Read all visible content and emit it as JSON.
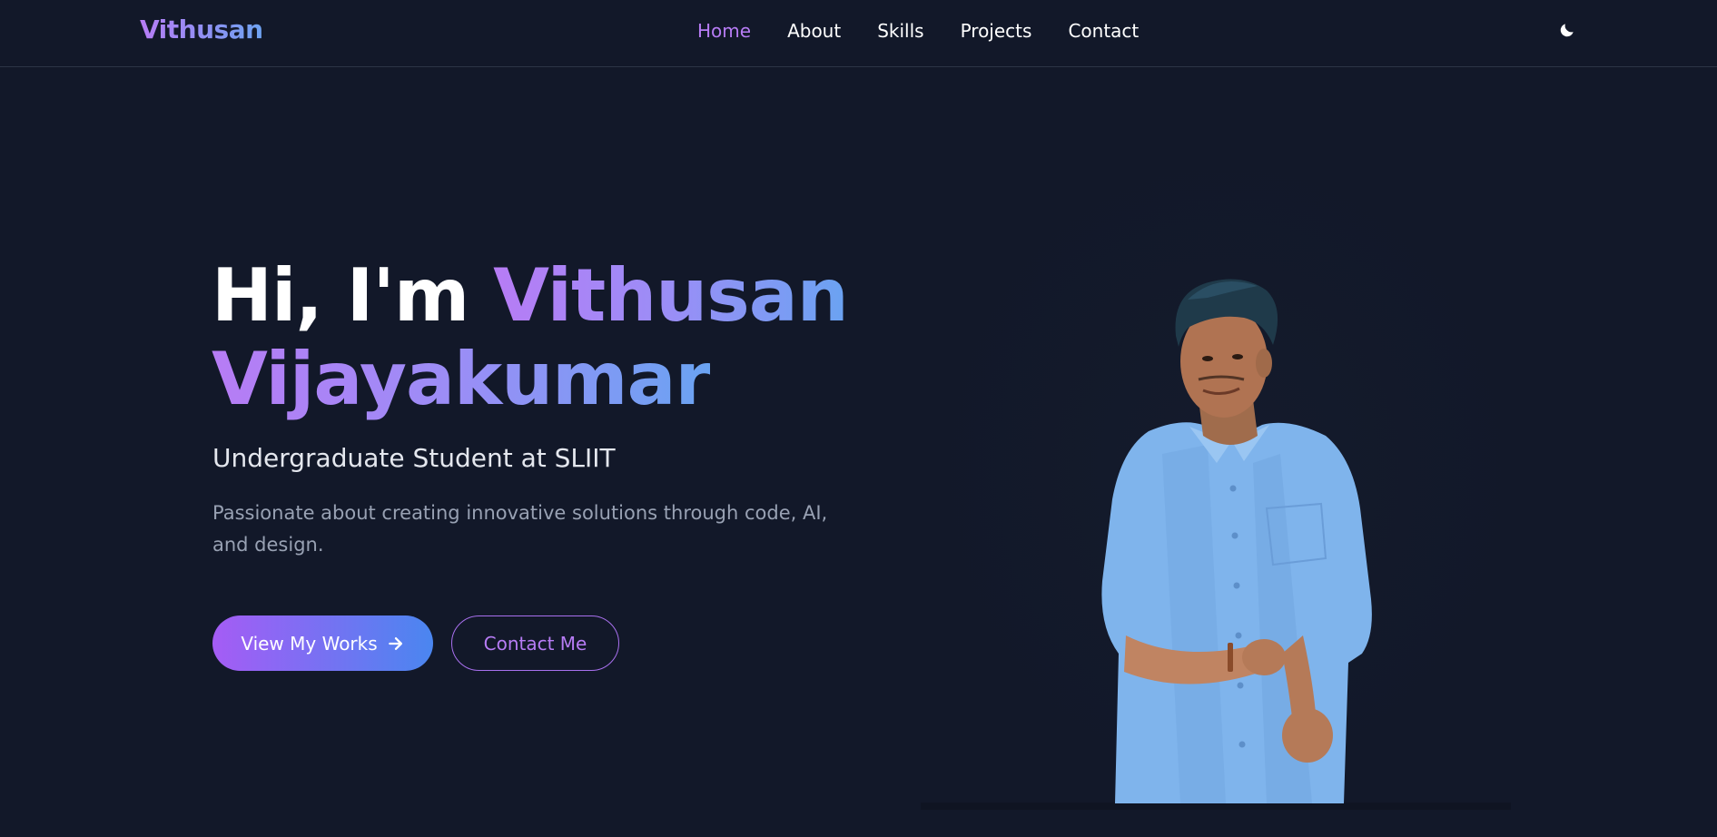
{
  "nav": {
    "brand": "Vithusan",
    "links": [
      {
        "label": "Home",
        "active": true
      },
      {
        "label": "About",
        "active": false
      },
      {
        "label": "Skills",
        "active": false
      },
      {
        "label": "Projects",
        "active": false
      },
      {
        "label": "Contact",
        "active": false
      }
    ],
    "theme_icon": "moon-icon"
  },
  "hero": {
    "greeting": "Hi, I'm ",
    "first_name": "Vithusan",
    "last_name": "Vijayakumar",
    "subtitle": "Undergraduate Student at SLIIT",
    "description": "Passionate about creating innovative solutions through code, AI, and design.",
    "primary_button": "View My Works",
    "primary_button_icon": "arrow-right-icon",
    "secondary_button": "Contact Me"
  },
  "colors": {
    "background": "#121829",
    "accent_purple": "#b77cf5",
    "accent_blue": "#6aa3f2",
    "shirt_blue": "#7fb4ec"
  }
}
